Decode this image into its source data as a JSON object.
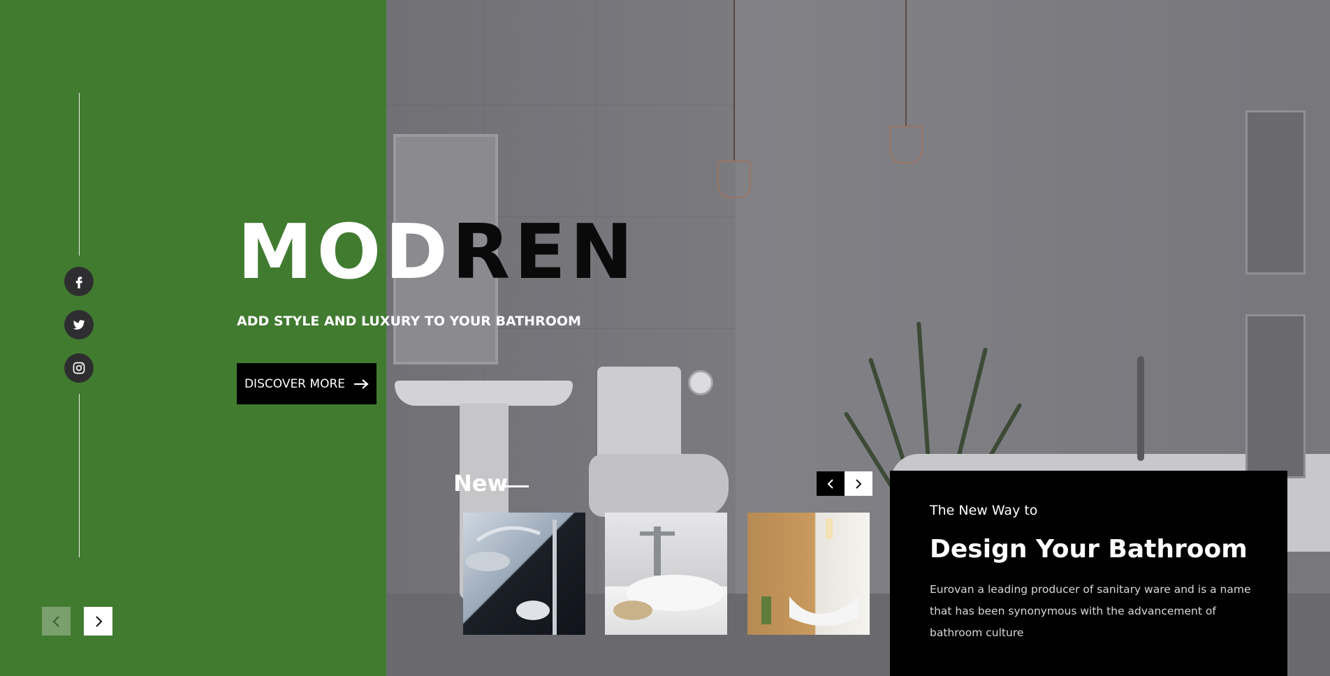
{
  "hero": {
    "title_light": "MOD",
    "title_dark": "REN",
    "subtitle": "ADD STYLE AND LUXURY TO YOUR BATHROOM",
    "cta_label": "DISCOVER MORE"
  },
  "social": {
    "items": [
      {
        "icon": "facebook-icon"
      },
      {
        "icon": "twitter-icon"
      },
      {
        "icon": "instagram-icon"
      }
    ]
  },
  "new_section": {
    "label": "New"
  },
  "card": {
    "kicker": "The New Way to",
    "title": "Design Your Bathroom",
    "body": "Eurovan a leading producer of sanitary ware and is a name that has been synonymous with the advancement of bathroom culture"
  },
  "colors": {
    "panel_green": "#417b30",
    "card_black": "#000000",
    "prev_button_green": "#79a06d"
  }
}
